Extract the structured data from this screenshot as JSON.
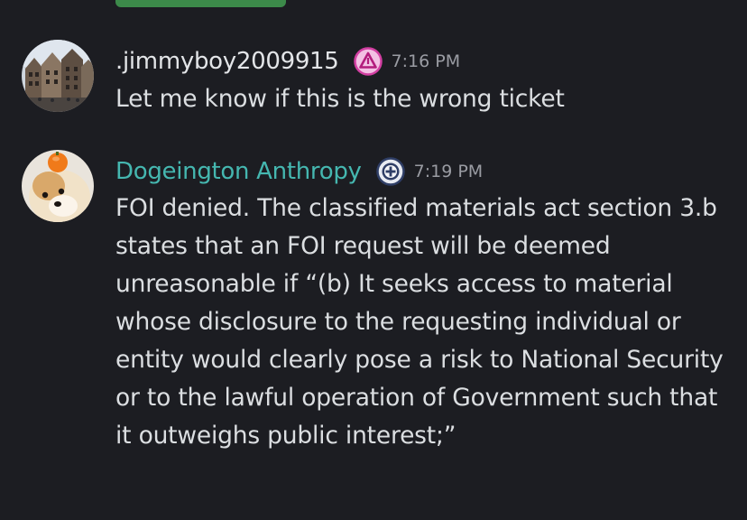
{
  "messages": [
    {
      "username": ".jimmyboy2009915",
      "timestamp": "7:16 PM",
      "role_icon": "pink-triangle-badge-icon",
      "name_color": "#e3e5e8",
      "text": "Let me know if this is the wrong ticket"
    },
    {
      "username": "Dogeington Anthropy",
      "timestamp": "7:19 PM",
      "role_icon": "shield-crest-badge-icon",
      "name_color": "#45b7b0",
      "text": "FOI denied. The classified materials act section 3.b states that an FOI request will be deemed unreasonable if “(b) It seeks access to material whose disclosure to the requesting individual or entity would clearly pose a risk to National Security or to the lawful operation of Government such that it outweighs public interest;”"
    }
  ],
  "colors": {
    "background": "#1c1d22",
    "top_button": "#3c8a4a",
    "timestamp": "#9a9ca3",
    "text": "#dbdee1"
  }
}
